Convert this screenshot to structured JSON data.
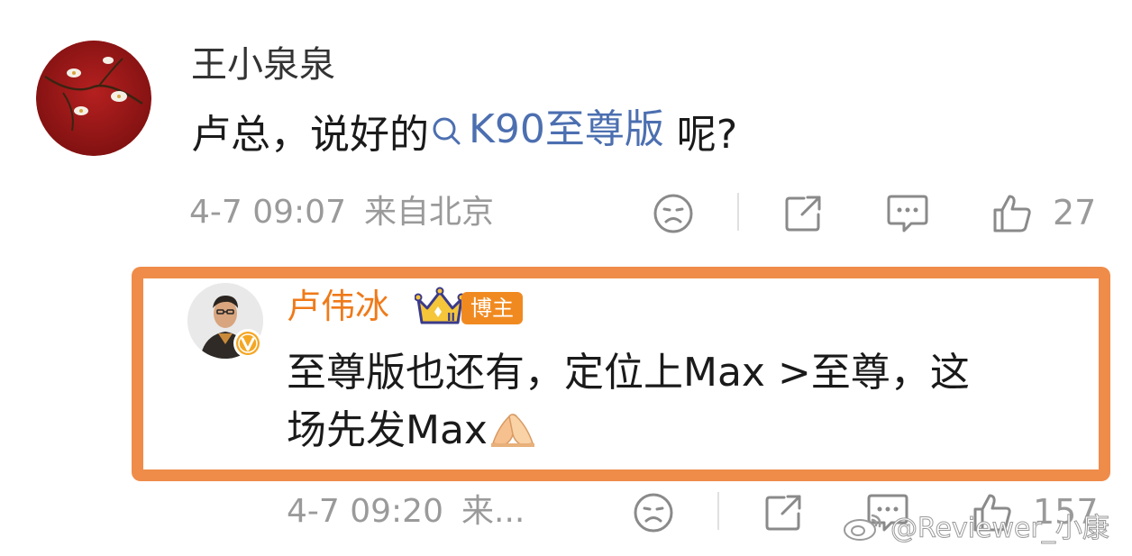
{
  "comment": {
    "username": "王小泉泉",
    "text_before": "卢总，说好的",
    "topic_link": "K90至尊版",
    "text_after": " 呢?",
    "date": "4-7 09:07",
    "location": "来自北京",
    "like_count": "27"
  },
  "reply": {
    "username": "卢伟冰",
    "badge": "博主",
    "crown_level": "II",
    "text_line1": "至尊版也还有，定位上Max >至尊，这",
    "text_line2": "场先发Max",
    "date": "4-7 09:20",
    "location": "来...",
    "like_count": "157"
  },
  "highlight_color": "#ef8c4a",
  "link_color": "#4c6fb0",
  "reply_name_color": "#ef7a1a",
  "icons": {
    "sad_face": "sad-face-icon",
    "share": "share-icon",
    "comment": "comment-icon",
    "like": "thumbs-up-icon",
    "search": "search-icon",
    "emoji": "pressed-hands-emoji"
  },
  "watermark": "@Reviewer_小康"
}
